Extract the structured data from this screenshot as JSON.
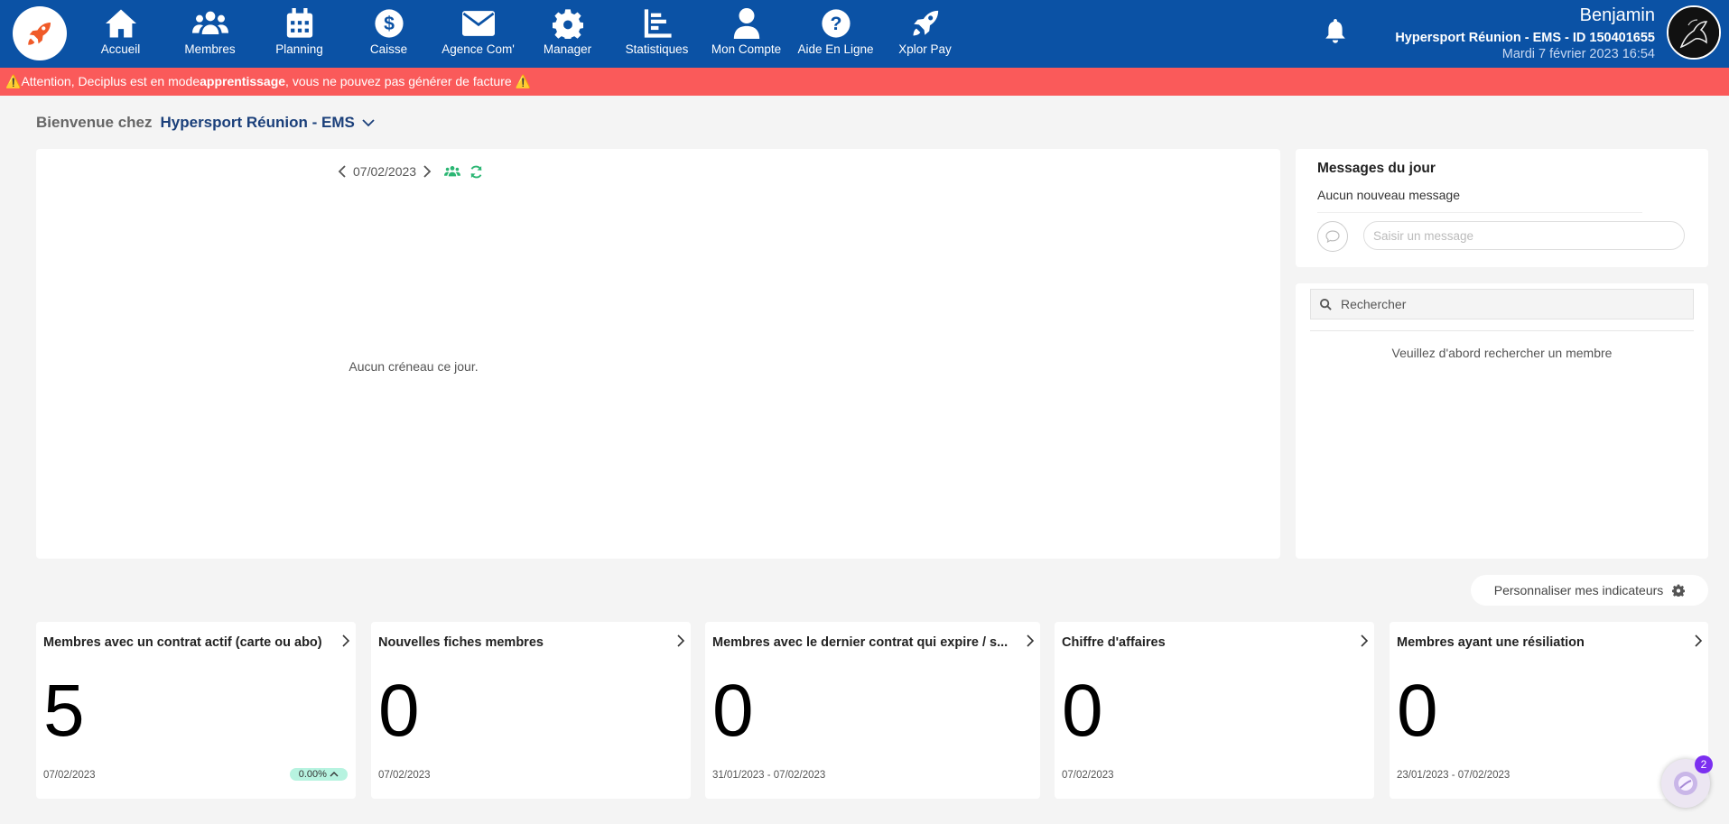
{
  "nav": {
    "items": [
      {
        "label": "Accueil",
        "icon": "home-icon"
      },
      {
        "label": "Membres",
        "icon": "users-icon"
      },
      {
        "label": "Planning",
        "icon": "calendar-icon"
      },
      {
        "label": "Caisse",
        "icon": "dollar-icon"
      },
      {
        "label": "Agence Com'",
        "icon": "envelope-icon"
      },
      {
        "label": "Manager",
        "icon": "gear-icon"
      },
      {
        "label": "Statistiques",
        "icon": "bar-chart-icon"
      },
      {
        "label": "Mon Compte",
        "icon": "user-icon"
      },
      {
        "label": "Aide En Ligne",
        "icon": "question-icon"
      },
      {
        "label": "Xplor Pay",
        "icon": "rocket-icon"
      }
    ]
  },
  "user": {
    "name": "Benjamin",
    "club": "Hypersport Réunion - EMS - ID 150401655",
    "datetime": "Mardi 7 février 2023 16:54"
  },
  "warning": {
    "prefix": "Attention, Deciplus est en mode",
    "mode": "apprentissage",
    "suffix": ", vous ne pouvez pas générer de facture"
  },
  "welcome": {
    "label": "Bienvenue chez",
    "club": "Hypersport Réunion - EMS"
  },
  "planning": {
    "date": "07/02/2023",
    "empty": "Aucun créneau ce jour."
  },
  "messages": {
    "title": "Messages du jour",
    "none": "Aucun nouveau message",
    "placeholder": "Saisir un message"
  },
  "search": {
    "placeholder": "Rechercher",
    "hint": "Veuillez d'abord rechercher un membre"
  },
  "customize": {
    "label": "Personnaliser mes indicateurs"
  },
  "indicators": [
    {
      "title": "Membres avec un contrat actif (carte ou abo)",
      "value": "5",
      "date": "07/02/2023",
      "pct": "0.00%"
    },
    {
      "title": "Nouvelles fiches membres",
      "value": "0",
      "date": "07/02/2023"
    },
    {
      "title": "Membres avec le dernier contrat qui expire / s...",
      "value": "0",
      "date": "31/01/2023 - 07/02/2023"
    },
    {
      "title": "Chiffre d'affaires",
      "value": "0",
      "date": "07/02/2023"
    },
    {
      "title": "Membres ayant une résiliation",
      "value": "0",
      "date": "23/01/2023 - 07/02/2023"
    }
  ],
  "chat": {
    "badge": "2"
  },
  "colors": {
    "nav": "#0b52a5",
    "warning": "#fa5a5a",
    "accent": "#2bb673",
    "logo": "#f05a28"
  }
}
